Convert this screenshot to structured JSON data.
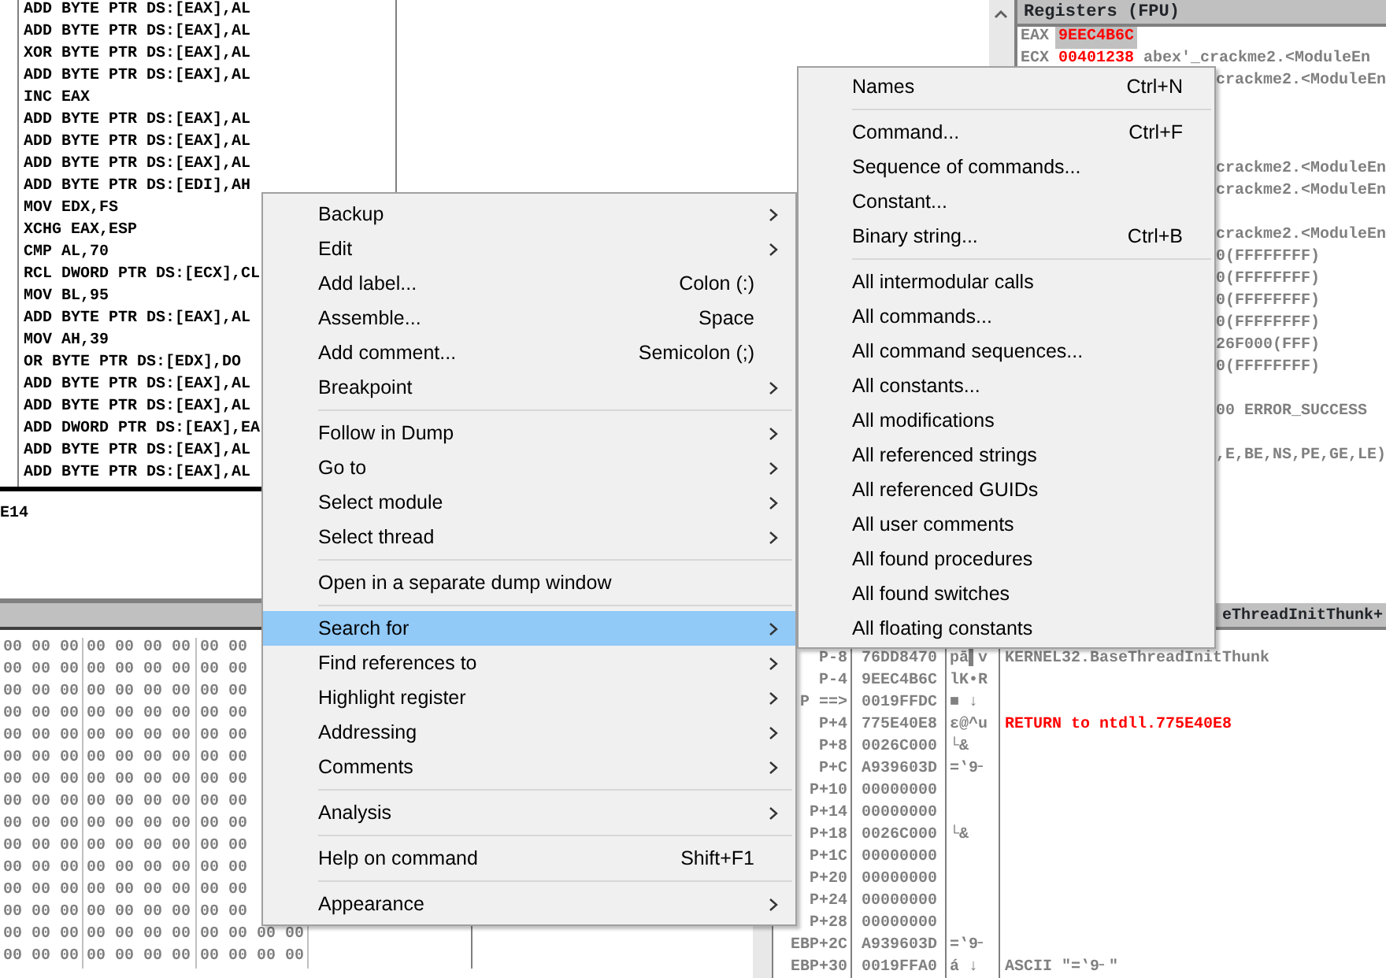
{
  "disassembly": {
    "lines": [
      "ADD BYTE PTR DS:[EAX],AL",
      "ADD BYTE PTR DS:[EAX],AL",
      "XOR BYTE PTR DS:[EAX],AL",
      "ADD BYTE PTR DS:[EAX],AL",
      "INC EAX",
      "ADD BYTE PTR DS:[EAX],AL",
      "ADD BYTE PTR DS:[EAX],AL",
      "ADD BYTE PTR DS:[EAX],AL",
      "ADD BYTE PTR DS:[EDI],AH",
      "MOV EDX,FS",
      "XCHG EAX,ESP",
      "CMP AL,70",
      "RCL DWORD PTR DS:[ECX],CL",
      "MOV BL,95",
      "ADD BYTE PTR DS:[EAX],AL",
      "MOV AH,39",
      "OR BYTE PTR DS:[EDX],DO",
      "ADD BYTE PTR DS:[EAX],AL",
      "ADD BYTE PTR DS:[EAX],AL",
      "ADD DWORD PTR DS:[EAX],EA",
      "ADD BYTE PTR DS:[EAX],AL",
      "ADD BYTE PTR DS:[EAX],AL"
    ]
  },
  "info_pane": {
    "text": "E14"
  },
  "registers": {
    "title": "Registers (FPU)",
    "rows": [
      {
        "kind": "register",
        "name": "EAX",
        "value": "9EEC4B6C",
        "changed": true,
        "selected": true
      },
      {
        "kind": "register",
        "name": "ECX",
        "value": "00401238",
        "changed": true,
        "selected": false,
        "comment": "abex'_crackme2.<ModuleEn"
      },
      {
        "kind": "fragment",
        "text": "crackme2.<ModuleEn"
      },
      {
        "kind": "gap"
      },
      {
        "kind": "gap"
      },
      {
        "kind": "gap"
      },
      {
        "kind": "fragment",
        "text": "crackme2.<ModuleEn"
      },
      {
        "kind": "fragment",
        "text": "crackme2.<ModuleEn"
      },
      {
        "kind": "gap"
      },
      {
        "kind": "fragment",
        "text": "crackme2.<ModuleEn"
      },
      {
        "kind": "fragment",
        "text": "0(FFFFFFFF)"
      },
      {
        "kind": "fragment",
        "text": "0(FFFFFFFF)"
      },
      {
        "kind": "fragment",
        "text": "0(FFFFFFFF)"
      },
      {
        "kind": "fragment",
        "text": "0(FFFFFFFF)"
      },
      {
        "kind": "fragment",
        "text": "26F000(FFF)"
      },
      {
        "kind": "fragment",
        "text": "0(FFFFFFFF)"
      },
      {
        "kind": "gap"
      },
      {
        "kind": "fragment",
        "text": "00 ERROR_SUCCESS"
      },
      {
        "kind": "gap"
      },
      {
        "kind": "fragment",
        "text": ",E,BE,NS,PE,GE,LE)"
      }
    ]
  },
  "dump": {
    "rows": [
      [
        "00 00 00",
        "00 00 00 00",
        "00 00"
      ],
      [
        "00 00 00",
        "00 00 00 00",
        "00 00"
      ],
      [
        "00 00 00",
        "00 00 00 00",
        "00 00"
      ],
      [
        "00 00 00",
        "00 00 00 00",
        "00 00"
      ],
      [
        "00 00 00",
        "00 00 00 00",
        "00 00"
      ],
      [
        "00 00 00",
        "00 00 00 00",
        "00 00"
      ],
      [
        "00 00 00",
        "00 00 00 00",
        "00 00"
      ],
      [
        "00 00 00",
        "00 00 00 00",
        "00 00"
      ],
      [
        "00 00 00",
        "00 00 00 00",
        "00 00"
      ],
      [
        "00 00 00",
        "00 00 00 00",
        "00 00"
      ],
      [
        "00 00 00",
        "00 00 00 00",
        "00 00"
      ],
      [
        "00 00 00",
        "00 00 00 00",
        "00 00"
      ],
      [
        "00 00 00",
        "00 00 00 00",
        "00 00"
      ],
      [
        "00 00 00",
        "00 00 00 00",
        "00 00 00 00"
      ],
      [
        "00 00 00",
        "00 00 00 00",
        "00 00 00 00"
      ]
    ]
  },
  "stack": {
    "header": "eThreadInitThunk+",
    "rows": [
      {
        "offset": "P-8",
        "value": "76DD8470",
        "ascii": "pā▌v",
        "comment": "KERNEL32.BaseThreadInitThunk",
        "highlight": false
      },
      {
        "offset": "P-4",
        "value": "9EEC4B6C",
        "ascii": "lK•R"
      },
      {
        "offset": "P ==>",
        "value": "0019FFDC",
        "ascii": "■ ↓"
      },
      {
        "offset": "P+4",
        "value": "775E40E8",
        "ascii": "ɛ@^u",
        "comment": "RETURN to ntdll.775E40E8",
        "highlight": true
      },
      {
        "offset": "P+8",
        "value": "0026C000",
        "ascii": "└&"
      },
      {
        "offset": "P+C",
        "value": "A939603D",
        "ascii": "=‛9╴"
      },
      {
        "offset": "P+10",
        "value": "00000000"
      },
      {
        "offset": "P+14",
        "value": "00000000"
      },
      {
        "offset": "P+18",
        "value": "0026C000",
        "ascii": "└&"
      },
      {
        "offset": "P+1C",
        "value": "00000000"
      },
      {
        "offset": "P+20",
        "value": "00000000"
      },
      {
        "offset": "P+24",
        "value": "00000000"
      },
      {
        "offset": "P+28",
        "value": "00000000"
      },
      {
        "offset": "EBP+2C",
        "value": "A939603D",
        "ascii": "=‛9╴"
      },
      {
        "offset": "EBP+30",
        "value": "0019FFA0",
        "ascii": "á ↓",
        "comment": "ASCII \"=‛9╴\"",
        "highlight": false
      }
    ]
  },
  "context_menu": {
    "items": [
      {
        "kind": "item",
        "label": "Backup",
        "submenu": true,
        "selected": false
      },
      {
        "kind": "item",
        "label": "Edit",
        "submenu": true,
        "selected": false
      },
      {
        "kind": "item",
        "label": "Add label...",
        "shortcut": "Colon (:)",
        "submenu": false,
        "selected": false
      },
      {
        "kind": "item",
        "label": "Assemble...",
        "shortcut": "Space",
        "submenu": false,
        "selected": false
      },
      {
        "kind": "item",
        "label": "Add comment...",
        "shortcut": "Semicolon (;)",
        "submenu": false,
        "selected": false
      },
      {
        "kind": "item",
        "label": "Breakpoint",
        "submenu": true,
        "selected": false
      },
      {
        "kind": "separator"
      },
      {
        "kind": "item",
        "label": "Follow in Dump",
        "submenu": true,
        "selected": false
      },
      {
        "kind": "item",
        "label": "Go to",
        "submenu": true,
        "selected": false
      },
      {
        "kind": "item",
        "label": "Select module",
        "submenu": true,
        "selected": false
      },
      {
        "kind": "item",
        "label": "Select thread",
        "submenu": true,
        "selected": false
      },
      {
        "kind": "separator"
      },
      {
        "kind": "item",
        "label": "Open in a separate dump window",
        "submenu": false,
        "selected": false
      },
      {
        "kind": "separator"
      },
      {
        "kind": "item",
        "label": "Search for",
        "submenu": true,
        "selected": true
      },
      {
        "kind": "item",
        "label": "Find references to",
        "submenu": true,
        "selected": false
      },
      {
        "kind": "item",
        "label": "Highlight register",
        "submenu": true,
        "selected": false
      },
      {
        "kind": "item",
        "label": "Addressing",
        "submenu": true,
        "selected": false
      },
      {
        "kind": "item",
        "label": "Comments",
        "submenu": true,
        "selected": false
      },
      {
        "kind": "separator"
      },
      {
        "kind": "item",
        "label": "Analysis",
        "submenu": true,
        "selected": false
      },
      {
        "kind": "separator"
      },
      {
        "kind": "item",
        "label": "Help on command",
        "shortcut": "Shift+F1",
        "submenu": false,
        "selected": false
      },
      {
        "kind": "separator"
      },
      {
        "kind": "item",
        "label": "Appearance",
        "submenu": true,
        "selected": false
      }
    ]
  },
  "search_submenu": {
    "items": [
      {
        "kind": "item",
        "label": "Names",
        "shortcut": "Ctrl+N",
        "selected": false
      },
      {
        "kind": "separator"
      },
      {
        "kind": "item",
        "label": "Command...",
        "shortcut": "Ctrl+F",
        "selected": false
      },
      {
        "kind": "item",
        "label": "Sequence of commands...",
        "selected": false
      },
      {
        "kind": "item",
        "label": "Constant...",
        "selected": false
      },
      {
        "kind": "item",
        "label": "Binary string...",
        "shortcut": "Ctrl+B",
        "selected": false
      },
      {
        "kind": "separator"
      },
      {
        "kind": "item",
        "label": "All intermodular calls",
        "selected": false
      },
      {
        "kind": "item",
        "label": "All commands...",
        "selected": false
      },
      {
        "kind": "item",
        "label": "All command sequences...",
        "selected": false
      },
      {
        "kind": "item",
        "label": "All constants...",
        "selected": false
      },
      {
        "kind": "item",
        "label": "All modifications",
        "selected": false
      },
      {
        "kind": "item",
        "label": "All referenced strings",
        "selected": false
      },
      {
        "kind": "item",
        "label": "All referenced GUIDs",
        "selected": false
      },
      {
        "kind": "item",
        "label": "All user comments",
        "selected": false
      },
      {
        "kind": "item",
        "label": "All found procedures",
        "selected": false
      },
      {
        "kind": "item",
        "label": "All found switches",
        "selected": false
      },
      {
        "kind": "item",
        "label": "All floating constants",
        "selected": false
      }
    ]
  }
}
